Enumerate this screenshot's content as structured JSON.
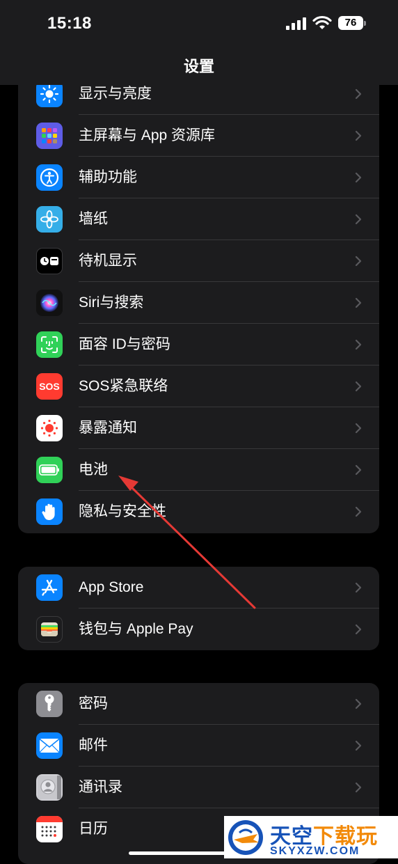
{
  "status_bar": {
    "time": "15:18",
    "battery_level": "76"
  },
  "nav": {
    "title": "设置"
  },
  "group1": [
    {
      "label": "显示与亮度",
      "icon": "display-brightness-icon",
      "color": "#0a84ff"
    },
    {
      "label": "主屏幕与 App 资源库",
      "icon": "home-screen-icon",
      "color": "#5e5ce6"
    },
    {
      "label": "辅助功能",
      "icon": "accessibility-icon",
      "color": "#0a84ff"
    },
    {
      "label": "墙纸",
      "icon": "wallpaper-icon",
      "color": "#35aee8"
    },
    {
      "label": "待机显示",
      "icon": "standby-icon",
      "color": "#000000"
    },
    {
      "label": "Siri与搜索",
      "icon": "siri-icon",
      "color": "#111111"
    },
    {
      "label": "面容 ID与密码",
      "icon": "face-id-icon",
      "color": "#30d158"
    },
    {
      "label": "SOS紧急联络",
      "icon": "sos-icon",
      "color": "#ff3b30"
    },
    {
      "label": "暴露通知",
      "icon": "exposure-notification-icon",
      "color": "#ffffff"
    },
    {
      "label": "电池",
      "icon": "battery-icon",
      "color": "#30d158"
    },
    {
      "label": "隐私与安全性",
      "icon": "privacy-hand-icon",
      "color": "#0a84ff"
    }
  ],
  "group2": [
    {
      "label": "App Store",
      "icon": "app-store-icon",
      "color": "#0a84ff"
    },
    {
      "label": "钱包与 Apple Pay",
      "icon": "wallet-icon",
      "color": "#1c1c1e"
    }
  ],
  "group3": [
    {
      "label": "密码",
      "icon": "key-icon",
      "color": "#8e8e93"
    },
    {
      "label": "邮件",
      "icon": "mail-icon",
      "color": "#0a84ff"
    },
    {
      "label": "通讯录",
      "icon": "contacts-icon",
      "color": "#c7c7cc"
    },
    {
      "label": "日历",
      "icon": "calendar-icon",
      "color": "#ffffff"
    }
  ],
  "watermark": {
    "name_blue": "天空",
    "name_orange": "下载玩",
    "url": "SKYXZW.COM"
  },
  "annotation": {
    "arrow_color": "#e53935"
  }
}
